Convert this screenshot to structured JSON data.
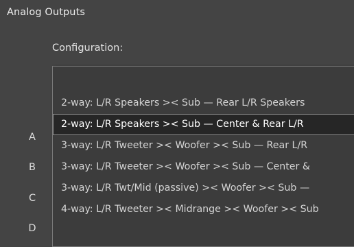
{
  "section": {
    "title": "Analog Outputs",
    "config_label": "Configuration:"
  },
  "rows": {
    "letters": [
      "A",
      "B",
      "C",
      "D"
    ]
  },
  "dropdown": {
    "selected_index": 1,
    "options": [
      "2-way: L/R Speakers >< Sub — Rear L/R Speakers",
      "2-way: L/R Speakers >< Sub — Center & Rear L/R",
      "3-way: L/R Tweeter >< Woofer >< Sub — Rear L/R",
      "3-way: L/R Tweeter >< Woofer >< Sub — Center &",
      "3-way: L/R Twt/Mid (passive) >< Woofer >< Sub —",
      "4-way: L/R Tweeter >< Midrange >< Woofer >< Sub"
    ]
  }
}
